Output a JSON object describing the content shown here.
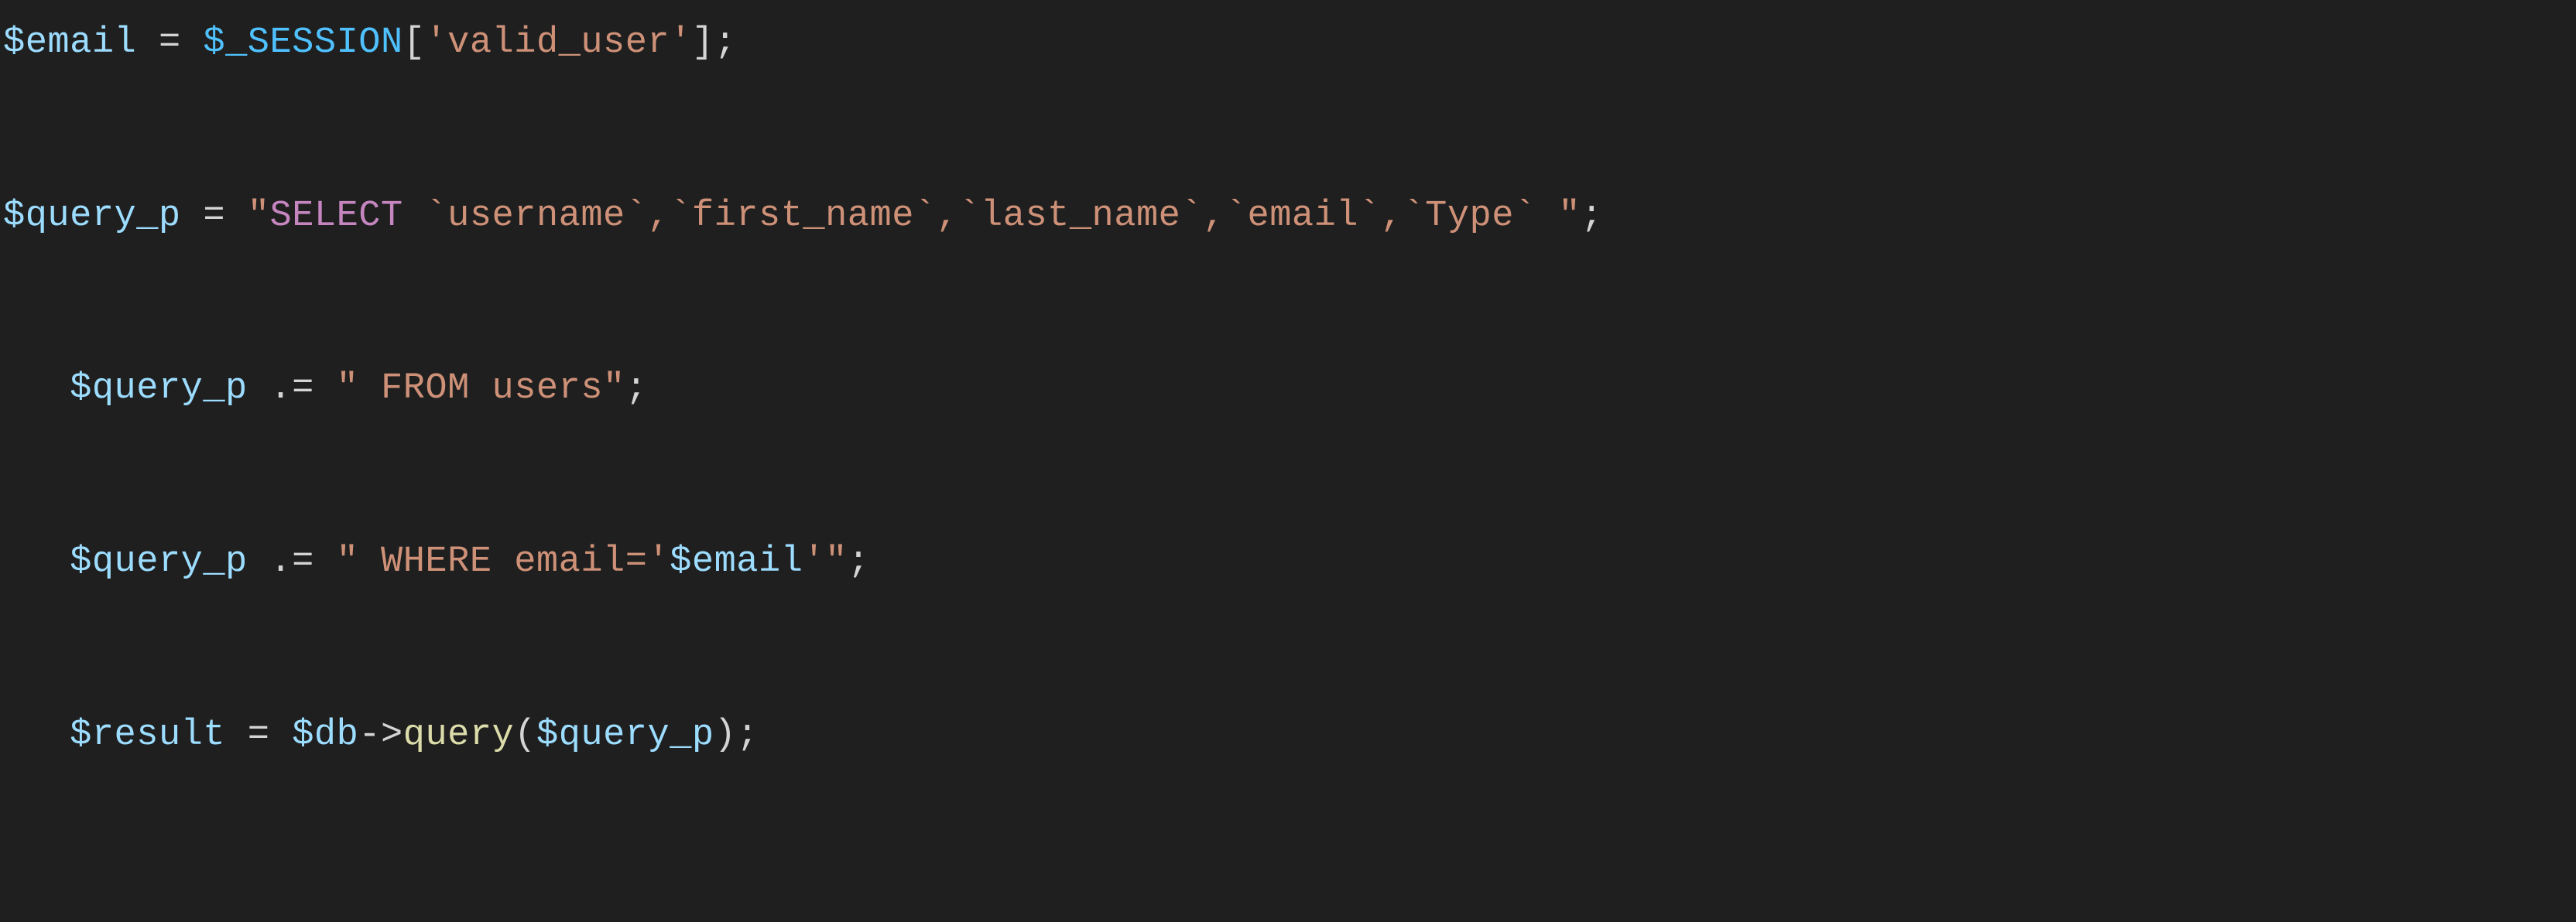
{
  "code": {
    "line1": {
      "var_email": "$email",
      "eq": " = ",
      "session": "$_SESSION",
      "lbrack": "[",
      "str_valid_user": "'valid_user'",
      "rbrack_semi": "];"
    },
    "blank1": "",
    "line2": {
      "var_query": "$query_p",
      "eq": " = ",
      "q1": "\"",
      "kw_select": "SELECT",
      "rest": " `username`,`first_name`,`last_name`,`email`,`Type` ",
      "q2": "\"",
      "semi": ";"
    },
    "blank2": "",
    "line3": {
      "indent": "   ",
      "var_query": "$query_p",
      "concat": " .= ",
      "str_from": "\" FROM users\"",
      "semi": ";"
    },
    "blank3": "",
    "line4": {
      "indent": "   ",
      "var_query": "$query_p",
      "concat": " .= ",
      "q1": "\" WHERE email='",
      "var_email": "$email",
      "q2": "'\"",
      "semi": ";"
    },
    "blank4": "",
    "line5": {
      "indent": "   ",
      "var_result": "$result",
      "eq": " = ",
      "var_db": "$db",
      "arrow": "->",
      "fn_query": "query",
      "lpar": "(",
      "arg": "$query_p",
      "rpar_semi": ");"
    }
  }
}
